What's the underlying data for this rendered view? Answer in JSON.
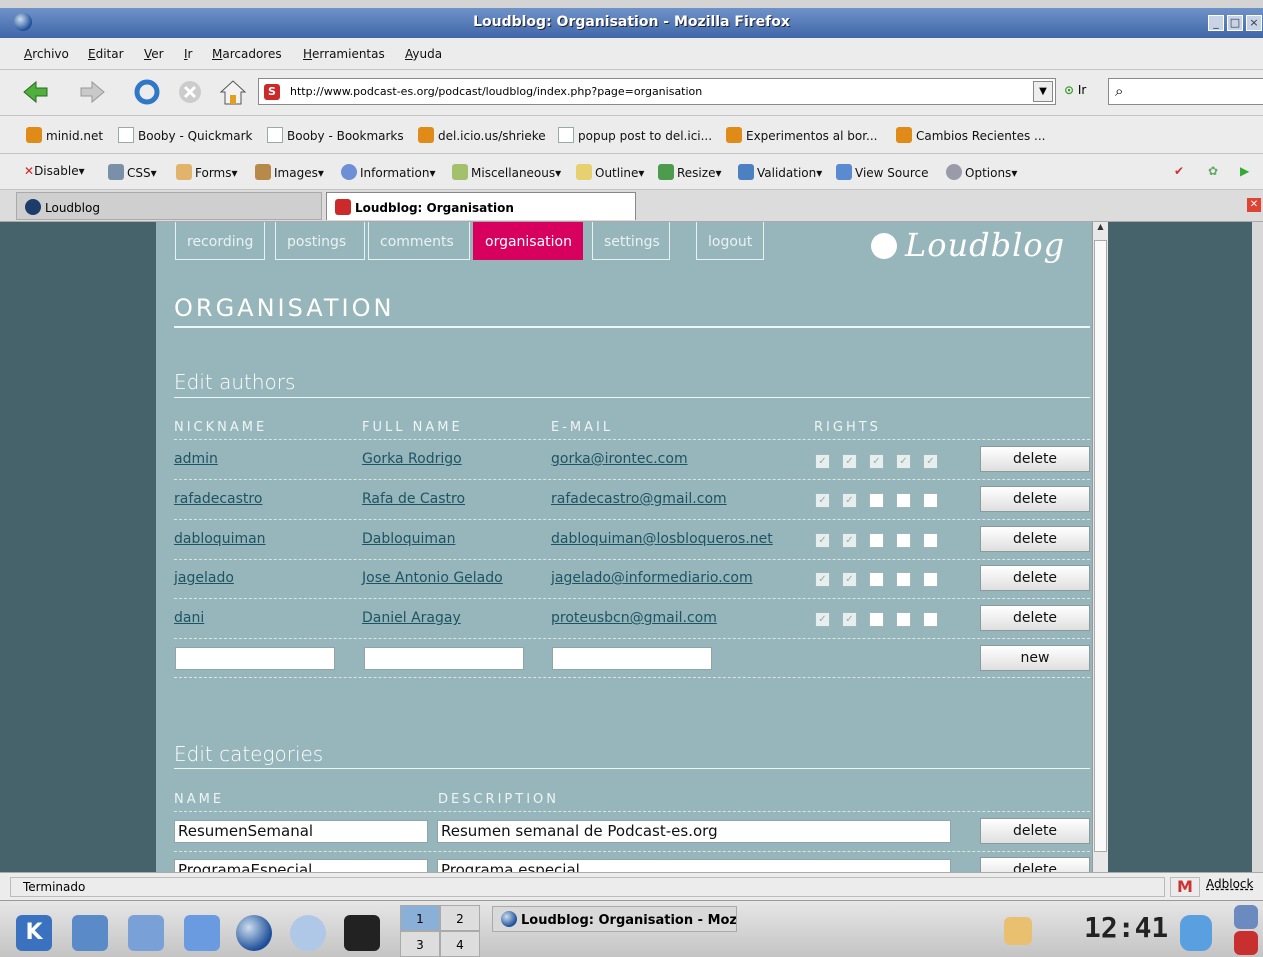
{
  "window": {
    "title": "Loudblog: Organisation - Mozilla Firefox"
  },
  "menubar": [
    "Archivo",
    "Editar",
    "Ver",
    "Ir",
    "Marcadores",
    "Herramientas",
    "Ayuda"
  ],
  "navbar": {
    "url": "http://www.podcast-es.org/podcast/loudblog/index.php?page=organisation",
    "go_label": "Ir"
  },
  "bookmarks": [
    "minid.net",
    "Booby - Quickmark",
    "Booby - Bookmarks",
    "del.icio.us/shrieke",
    "popup post to del.ici...",
    "Experimentos al bor...",
    "Cambios Recientes ..."
  ],
  "devbar": [
    "Disable",
    "CSS",
    "Forms",
    "Images",
    "Information",
    "Miscellaneous",
    "Outline",
    "Resize",
    "Validation",
    "View Source",
    "Options"
  ],
  "tabs": [
    {
      "label": "Loudblog"
    },
    {
      "label": "Loudblog: Organisation"
    }
  ],
  "page": {
    "nav": [
      "recording",
      "postings",
      "comments",
      "organisation",
      "settings",
      "logout"
    ],
    "active_nav": "organisation",
    "logo": "Loudblog",
    "title": "ORGANISATION",
    "authors": {
      "heading": "Edit authors",
      "columns": [
        "NICKNAME",
        "FULL NAME",
        "E-MAIL",
        "RIGHTS"
      ],
      "rows": [
        {
          "nick": "admin",
          "name": "Gorka Rodrigo",
          "email": "gorka@irontec.com",
          "rights": [
            true,
            true,
            true,
            true,
            true
          ]
        },
        {
          "nick": "rafadecastro",
          "name": "Rafa de Castro",
          "email": "rafadecastro@gmail.com",
          "rights": [
            true,
            true,
            false,
            false,
            false
          ]
        },
        {
          "nick": "dabloquiman",
          "name": "Dabloquiman",
          "email": "dabloquiman@losbloqueros.net",
          "rights": [
            true,
            true,
            false,
            false,
            false
          ]
        },
        {
          "nick": "jagelado",
          "name": "Jose Antonio Gelado",
          "email": "jagelado@informediario.com",
          "rights": [
            true,
            true,
            false,
            false,
            false
          ]
        },
        {
          "nick": "dani",
          "name": "Daniel Aragay",
          "email": "proteusbcn@gmail.com",
          "rights": [
            true,
            true,
            false,
            false,
            false
          ]
        }
      ],
      "delete_label": "delete",
      "new_label": "new"
    },
    "categories": {
      "heading": "Edit categories",
      "columns": [
        "NAME",
        "DESCRIPTION"
      ],
      "rows": [
        {
          "name": "ResumenSemanal",
          "description": "Resumen semanal de Podcast-es.org"
        },
        {
          "name": "ProgramaEspecial",
          "description": "Programa especial"
        }
      ],
      "delete_label": "delete"
    }
  },
  "statusbar": {
    "text": "Terminado",
    "adblock": "Adblock"
  },
  "taskbar": {
    "desktops": [
      "1",
      "2",
      "3",
      "4"
    ],
    "current_desktop": "1",
    "task": "Loudblog: Organisation - Mozill",
    "clock": "12:41"
  },
  "colors": {
    "accent": "#d8005e",
    "page_bg": "#97b6bb",
    "outer_bg": "#46626a",
    "link": "#1d5463"
  }
}
